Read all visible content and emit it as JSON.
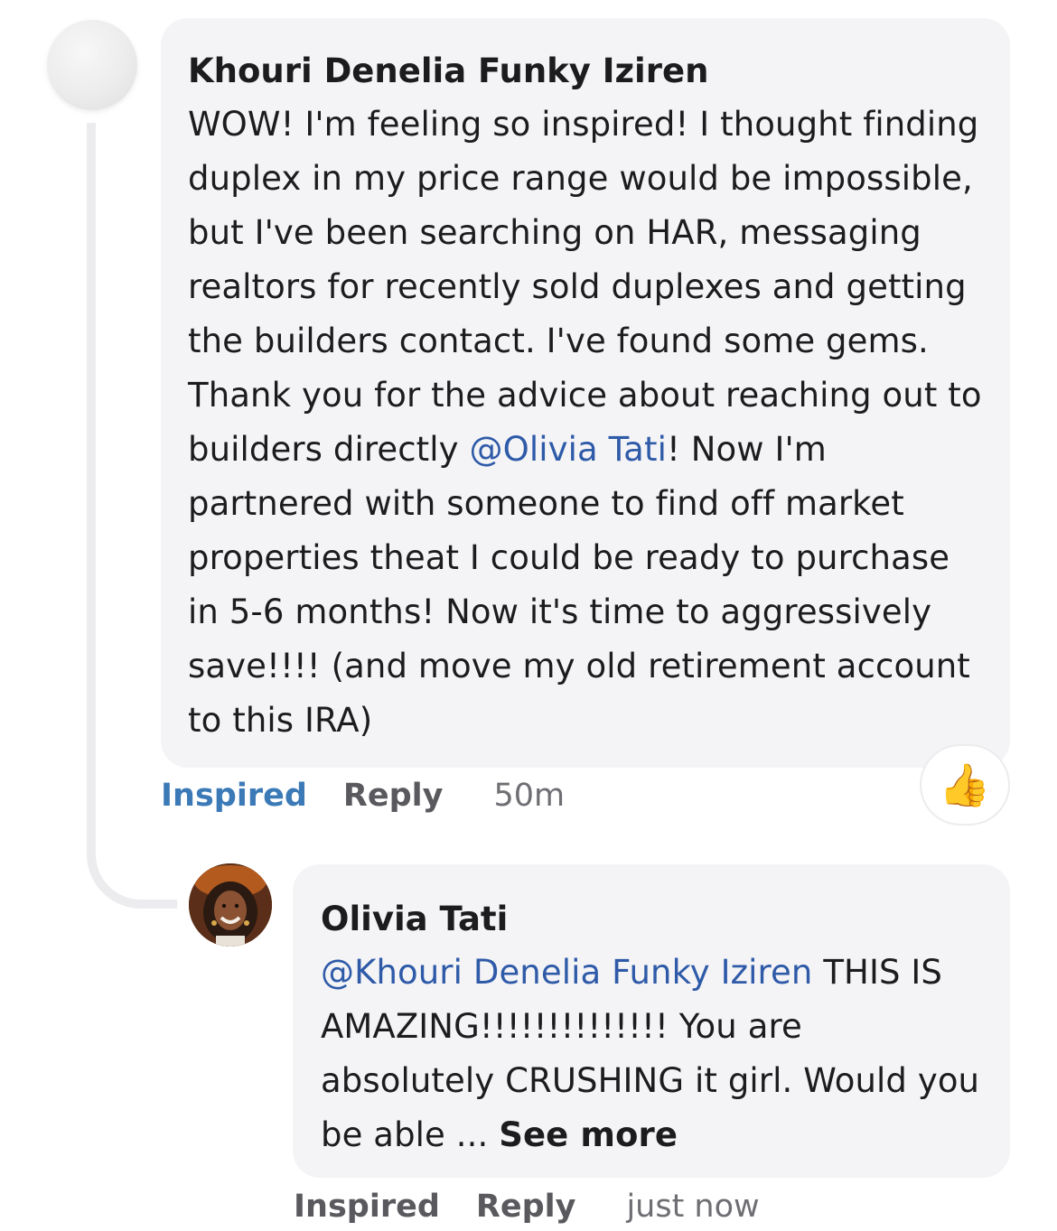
{
  "comment": {
    "author": "Khouri Denelia Funky Iziren",
    "text_before_mention": "WOW! I'm feeling so inspired! I thought finding duplex in my price range would be impossible, but I've been searching on HAR, messaging realtors for recently sold duplexes and getting the builders contact. I've found some gems. Thank you for the advice about reaching out to builders directly ",
    "mention": "@Olivia Tati",
    "text_after_mention": "! Now I'm partnered with someone to find  off market properties theat I could be ready to purchase in 5-6 months! Now it's time to aggressively save!!!! (and move my old retirement account to this IRA)",
    "actions": {
      "inspired": "Inspired",
      "reply": "Reply",
      "time": "50m"
    },
    "reaction": "👍"
  },
  "reply": {
    "author": "Olivia Tati",
    "mention": "@Khouri Denelia Funky Iziren",
    "text": " THIS IS AMAZING!!!!!!!!!!!!!! You are absolutely CRUSHING it girl. Would you be able ... ",
    "see_more": "See more",
    "actions": {
      "inspired": "Inspired",
      "reply": "Reply",
      "time": "just now"
    }
  },
  "colors": {
    "mention": "#2e5aa8",
    "inspired_active": "#3b7ab7",
    "bubble": "#f4f4f6",
    "thread_line": "#ececee"
  }
}
